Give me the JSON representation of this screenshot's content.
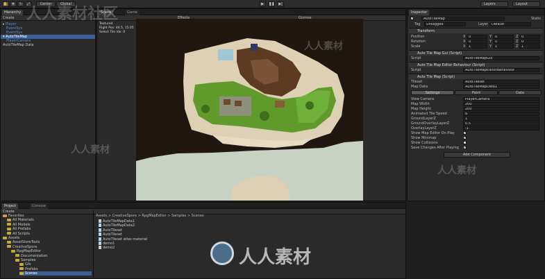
{
  "toolbar": {
    "pivot": "Center",
    "space": "Global",
    "layers": "Layers",
    "layout": "Layout"
  },
  "hierarchy": {
    "tab": "Hierarchy",
    "create": "Create",
    "items": [
      "Player",
      "EventSys",
      "EventSys",
      "AutoTileMap",
      "PlayerCamera",
      "AutoTileMap Data"
    ]
  },
  "scene": {
    "tab": "Scene",
    "game_tab": "Game",
    "effects": "Effects",
    "gizmos": "Gizmos",
    "overlay": [
      "Textured",
      "Right Pos: 44.5, 15.05",
      "Select Tile Idx: 0"
    ]
  },
  "inspector": {
    "tab": "Inspector",
    "object_name": "AutoTileMap",
    "static": "Static",
    "tag_label": "Tag",
    "tag_value": "Untagged",
    "layer_label": "Layer",
    "layer_value": "Default",
    "transform": {
      "title": "Transform",
      "rows": [
        {
          "label": "Position",
          "x": "0",
          "y": "0",
          "z": "0"
        },
        {
          "label": "Rotation",
          "x": "0",
          "y": "0",
          "z": "0"
        },
        {
          "label": "Scale",
          "x": "1",
          "y": "1",
          "z": "1"
        }
      ]
    },
    "gui": {
      "title": "Auto Tile Map Gui (Script)",
      "script_label": "Script",
      "script_value": "AutoTileMapGui"
    },
    "editor": {
      "title": "Auto Tile Map Editor Behaviour (Script)",
      "script_label": "Script",
      "script_value": "AutoTileMapEditorBehaviour"
    },
    "map": {
      "title": "Auto Tile Map (Script)",
      "tileset_label": "Tileset",
      "tileset_value": "AutoTileset",
      "mapdata_label": "Map Data",
      "mapdata_value": "AutoTileMapData1",
      "tabs": [
        "Settings",
        "Paint",
        "Data"
      ],
      "fields": [
        {
          "label": "View Camera",
          "value": "PlayerCamera"
        },
        {
          "label": "Map Width",
          "value": "200"
        },
        {
          "label": "Map Height",
          "value": "200"
        },
        {
          "label": "Animated Tile Speed",
          "value": "6"
        },
        {
          "label": "GroundLayerZ",
          "value": "1"
        },
        {
          "label": "GroundOverlayLayerZ",
          "value": "0.5"
        },
        {
          "label": "OverlayLayerZ",
          "value": "-1"
        }
      ],
      "checks": [
        {
          "label": "Show Map Editor On Play",
          "value": "✓"
        },
        {
          "label": "Show Minimap",
          "value": "✓"
        },
        {
          "label": "Show Collisions",
          "value": ""
        },
        {
          "label": "Save Changes After Playing",
          "value": "✓"
        }
      ],
      "add_component": "Add Component"
    }
  },
  "project": {
    "tab": "Project",
    "console_tab": "Console",
    "create": "Create",
    "breadcrumb": "Assets > CreativeSpore > RpgMapEditor > Samples > Scenes",
    "tree": [
      {
        "label": "Favorites",
        "indent": 0
      },
      {
        "label": "All Materials",
        "indent": 1
      },
      {
        "label": "All Models",
        "indent": 1
      },
      {
        "label": "All Prefabs",
        "indent": 1
      },
      {
        "label": "All Scripts",
        "indent": 1
      },
      {
        "label": "Assets",
        "indent": 0
      },
      {
        "label": "AssetStoreTools",
        "indent": 1
      },
      {
        "label": "CreativeSpore",
        "indent": 1
      },
      {
        "label": "RpgMapEditor",
        "indent": 2
      },
      {
        "label": "Documentation",
        "indent": 3
      },
      {
        "label": "Samples",
        "indent": 3
      },
      {
        "label": "Gfx",
        "indent": 4
      },
      {
        "label": "Prefabs",
        "indent": 4
      },
      {
        "label": "Scenes",
        "indent": 4
      }
    ],
    "files": [
      "AutoTileMapData1",
      "AutoTileMapData2",
      "AutoTileset",
      "AutoTileset",
      "AutoTileset atlas material",
      "demo1",
      "demo2"
    ]
  },
  "watermark": {
    "top": "人人素材社区",
    "center": "人人素材",
    "small": "人人素材"
  },
  "colors": {
    "ocean": "#c7d2c4",
    "sand": "#ded0b4",
    "grass": "#5f9a2a",
    "cliff": "#5c3b22",
    "void": "#201810"
  }
}
